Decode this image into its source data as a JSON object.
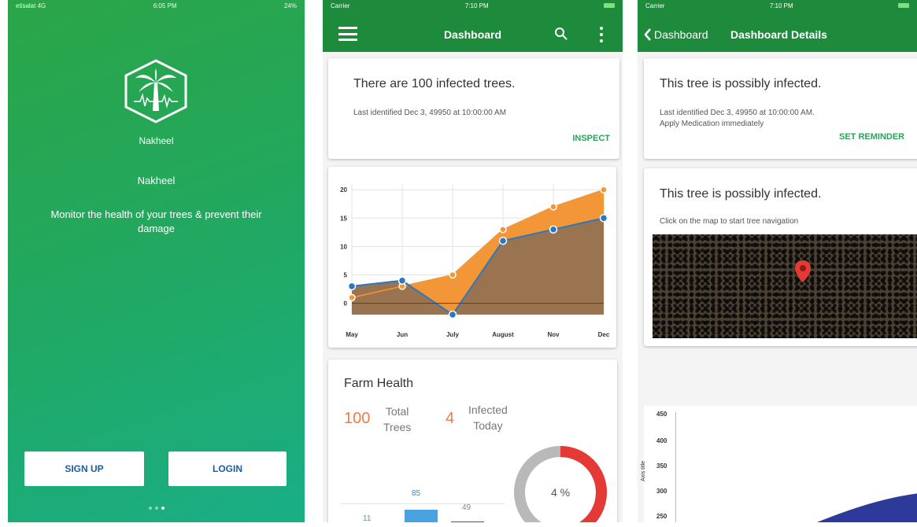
{
  "screen1": {
    "status": {
      "carrier": "etisalat 4G",
      "time": "6:05 PM",
      "battery": "24%"
    },
    "logo_label": "Nakheel",
    "app_name": "Nakheel",
    "tagline": "Monitor the health of your trees & prevent their damage",
    "signup_label": "SIGN UP",
    "login_label": "LOGIN"
  },
  "screen2": {
    "status": {
      "carrier": "Carrier",
      "time": "7:10 PM"
    },
    "title": "Dashboard",
    "alert_title": "There are 100 infected trees.",
    "alert_sub": "Last identified Dec 3, 49950 at 10:00:00 AM",
    "inspect_label": "INSPECT",
    "farm_health_title": "Farm Health",
    "total_trees_value": "100",
    "total_trees_label_1": "Total",
    "total_trees_label_2": "Trees",
    "infected_value": "4",
    "infected_label_1": "Infected",
    "infected_label_2": "Today",
    "donut_label": "4 %",
    "donut_fraction": 0.52,
    "bar_labels": [
      "11",
      "85",
      "49"
    ],
    "colors": {
      "orange": "#f29638",
      "blue": "#2a78c2",
      "brown": "#9a7451",
      "green_bar": "#1e8a3c",
      "red": "#e53935"
    }
  },
  "screen3": {
    "status": {
      "carrier": "Carrier",
      "time": "7:10 PM"
    },
    "back_label": "Dashboard",
    "title": "Dashboard Details",
    "card1_title": "This tree is possibly infected.",
    "card1_line1": "Last identified Dec 3, 49950 at 10:00:00 AM.",
    "card1_line2": "Apply Medication immediately",
    "reminder_label": "SET REMINDER",
    "card2_title": "This tree is possibly infected.",
    "card2_sub": "Click on the map to start tree navigation",
    "axis_title": "Axis title",
    "y_ticks": [
      "450",
      "400",
      "350",
      "300",
      "250"
    ]
  },
  "chart_data": {
    "type": "area",
    "categories": [
      "May",
      "Jun",
      "July",
      "August",
      "Nov",
      "Dec"
    ],
    "series": [
      {
        "values": [
          1,
          3,
          5,
          13,
          17,
          20
        ]
      },
      {
        "values": [
          3,
          4,
          -2,
          11,
          13,
          15
        ]
      }
    ],
    "y_ticks": [
      "20",
      "15",
      "10",
      "5",
      "0"
    ],
    "ylim": [
      -2,
      21
    ],
    "grid": true
  }
}
